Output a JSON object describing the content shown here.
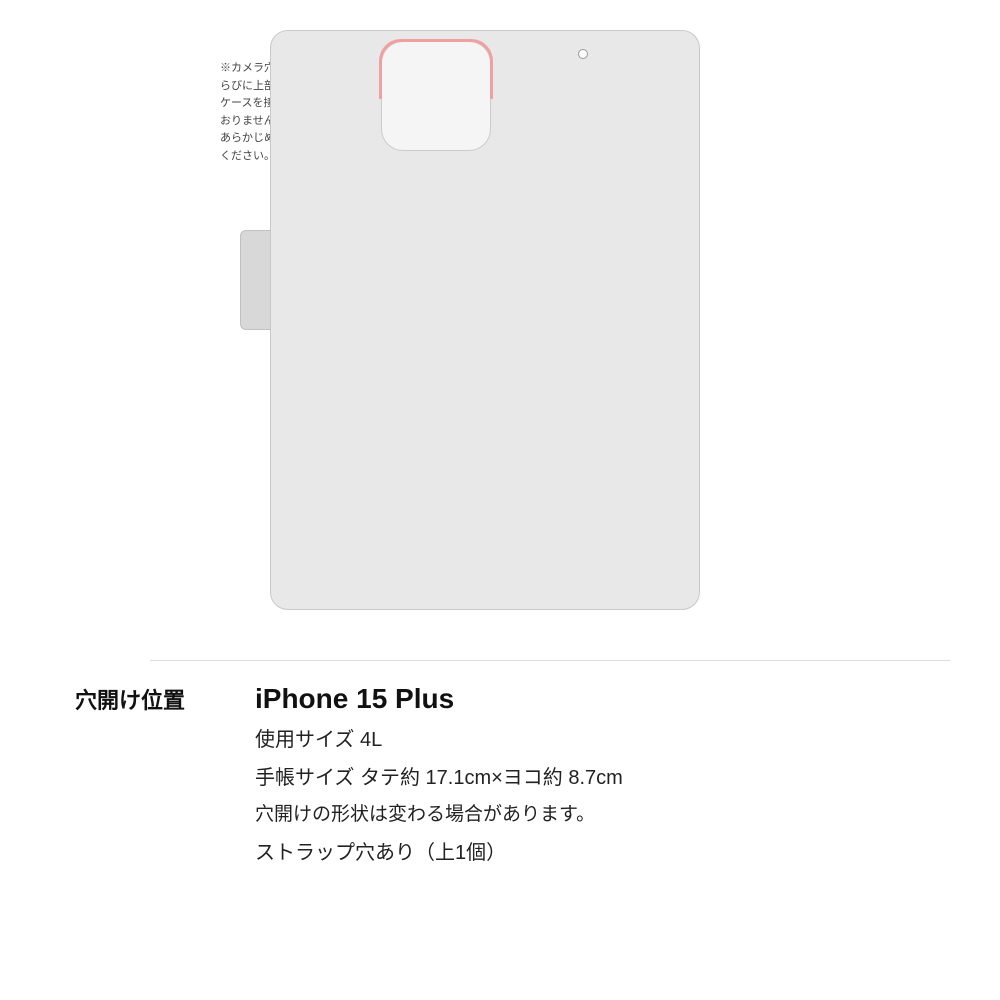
{
  "page": {
    "background_color": "#ffffff"
  },
  "note": {
    "text": "※カメラ穴の横ならびに上部は\nケースを接着しておりません。\nあらかじめご了承ください。"
  },
  "case": {
    "color": "#e8e8e8",
    "border_color": "#c8c8c8",
    "camera_cutout_color": "#f5f5f5",
    "camera_accent_color": "#f0a0a0",
    "belt_color": "#d8d8d8",
    "strap_hole_color": "#ffffff"
  },
  "info_section": {
    "label": "穴開け位置",
    "model": "iPhone 15 Plus",
    "size_label": "使用サイズ 4L",
    "dimensions_label": "手帳サイズ タテ約 17.1cm×ヨコ約 8.7cm",
    "shape_note": "穴開けの形状は変わる場合があります。",
    "strap_note": "ストラップ穴あり（上1個）"
  }
}
